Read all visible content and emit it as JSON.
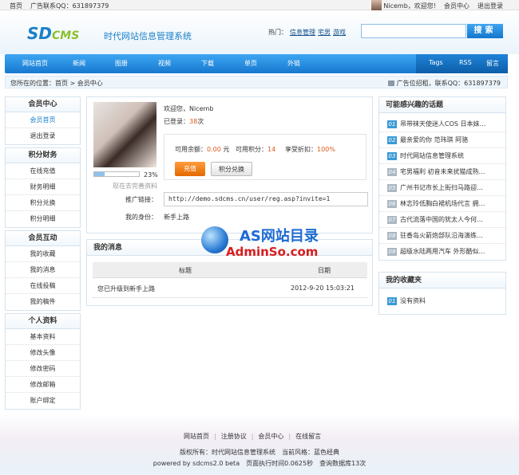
{
  "topbar": {
    "home": "首页",
    "ad": "广告联系QQ：631897379",
    "user": "Nicemb，欢迎您!",
    "center": "会员中心",
    "logout": "退出登录"
  },
  "header": {
    "logo": "SD",
    "logo2": "CMS",
    "slogan": "时代网站信息管理系统",
    "hot_label": "热门：",
    "hot": [
      "信息管理",
      "宅男",
      "游戏"
    ],
    "search_btn": "搜索"
  },
  "nav": [
    "网站首页",
    "新闻",
    "图册",
    "视频",
    "下载",
    "单页",
    "外链"
  ],
  "nav_right": [
    "Tags",
    "RSS",
    "留言"
  ],
  "crumb": {
    "left": "您所在的位置：首页 > 会员中心",
    "right": "广告位招租，联系QQ：631897379"
  },
  "side": [
    {
      "title": "会员中心",
      "items": [
        "会员首页",
        "退出登录"
      ]
    },
    {
      "title": "积分财务",
      "items": [
        "在线充值",
        "财务明细",
        "积分兑换",
        "积分明细"
      ]
    },
    {
      "title": "会员互动",
      "items": [
        "我的收藏",
        "我的消息",
        "在线投稿",
        "我的稿件"
      ]
    },
    {
      "title": "个人资料",
      "items": [
        "基本资料",
        "修改头像",
        "修改密码",
        "修改邮箱",
        "账户绑定"
      ]
    }
  ],
  "profile": {
    "welcome": "欢迎您，Nicemb",
    "login_label": "已登录：",
    "login_count": "38",
    "login_unit": "次",
    "balance_label": "可用余额：",
    "balance": "0.00",
    "balance_unit": "元",
    "points_label": "可用积分：",
    "points": "14",
    "discount_label": "享受折扣：",
    "discount": "100%",
    "recharge": "充值",
    "exchange": "积分兑换",
    "progress": "23%",
    "progress_value": 0.23,
    "progress_link": "现在去完善资料",
    "promo_label": "推广链接：",
    "promo_url": "http://demo.sdcms.cn/user/reg.asp?invite=1",
    "identity_label": "我的身份：",
    "identity": "新手上路"
  },
  "messages": {
    "title": "我的消息",
    "col_title": "标题",
    "col_date": "日期",
    "rows": [
      {
        "title": "您已升级到新手上路",
        "date": "2012-9-20 15:03:21"
      }
    ]
  },
  "interest": {
    "title": "可能感兴趣的话题",
    "items": [
      "吊带袜天使迷人COS 日本妹…",
      "最亲爱的你 范玮琪 阿骆",
      "时代网站信息管理系统",
      "宅男福利 初音未来扰猫成熟…",
      "广州书记市长上街扫马路迎…",
      "林志玲低胸白裙机场代言 拥…",
      "古代流落中国的犹太人今何…",
      "驻香岛火箭炮部队沿海演练…",
      "超级水陆两用汽车 外形酷似…"
    ]
  },
  "favorites": {
    "title": "我的收藏夹",
    "items": [
      "没有资料"
    ]
  },
  "watermark": {
    "line1": "AS网站目录",
    "line2": "AdminSo.com"
  },
  "footer": {
    "links": [
      "网站首页",
      "注册协议",
      "会员中心",
      "在线留言"
    ],
    "line1": "版权所有：时代网站信息管理系统　当前风格：蓝色经典",
    "line2": "powered by sdcms2.0 beta　页面执行时间0.0625秒　查询数据库13次"
  }
}
